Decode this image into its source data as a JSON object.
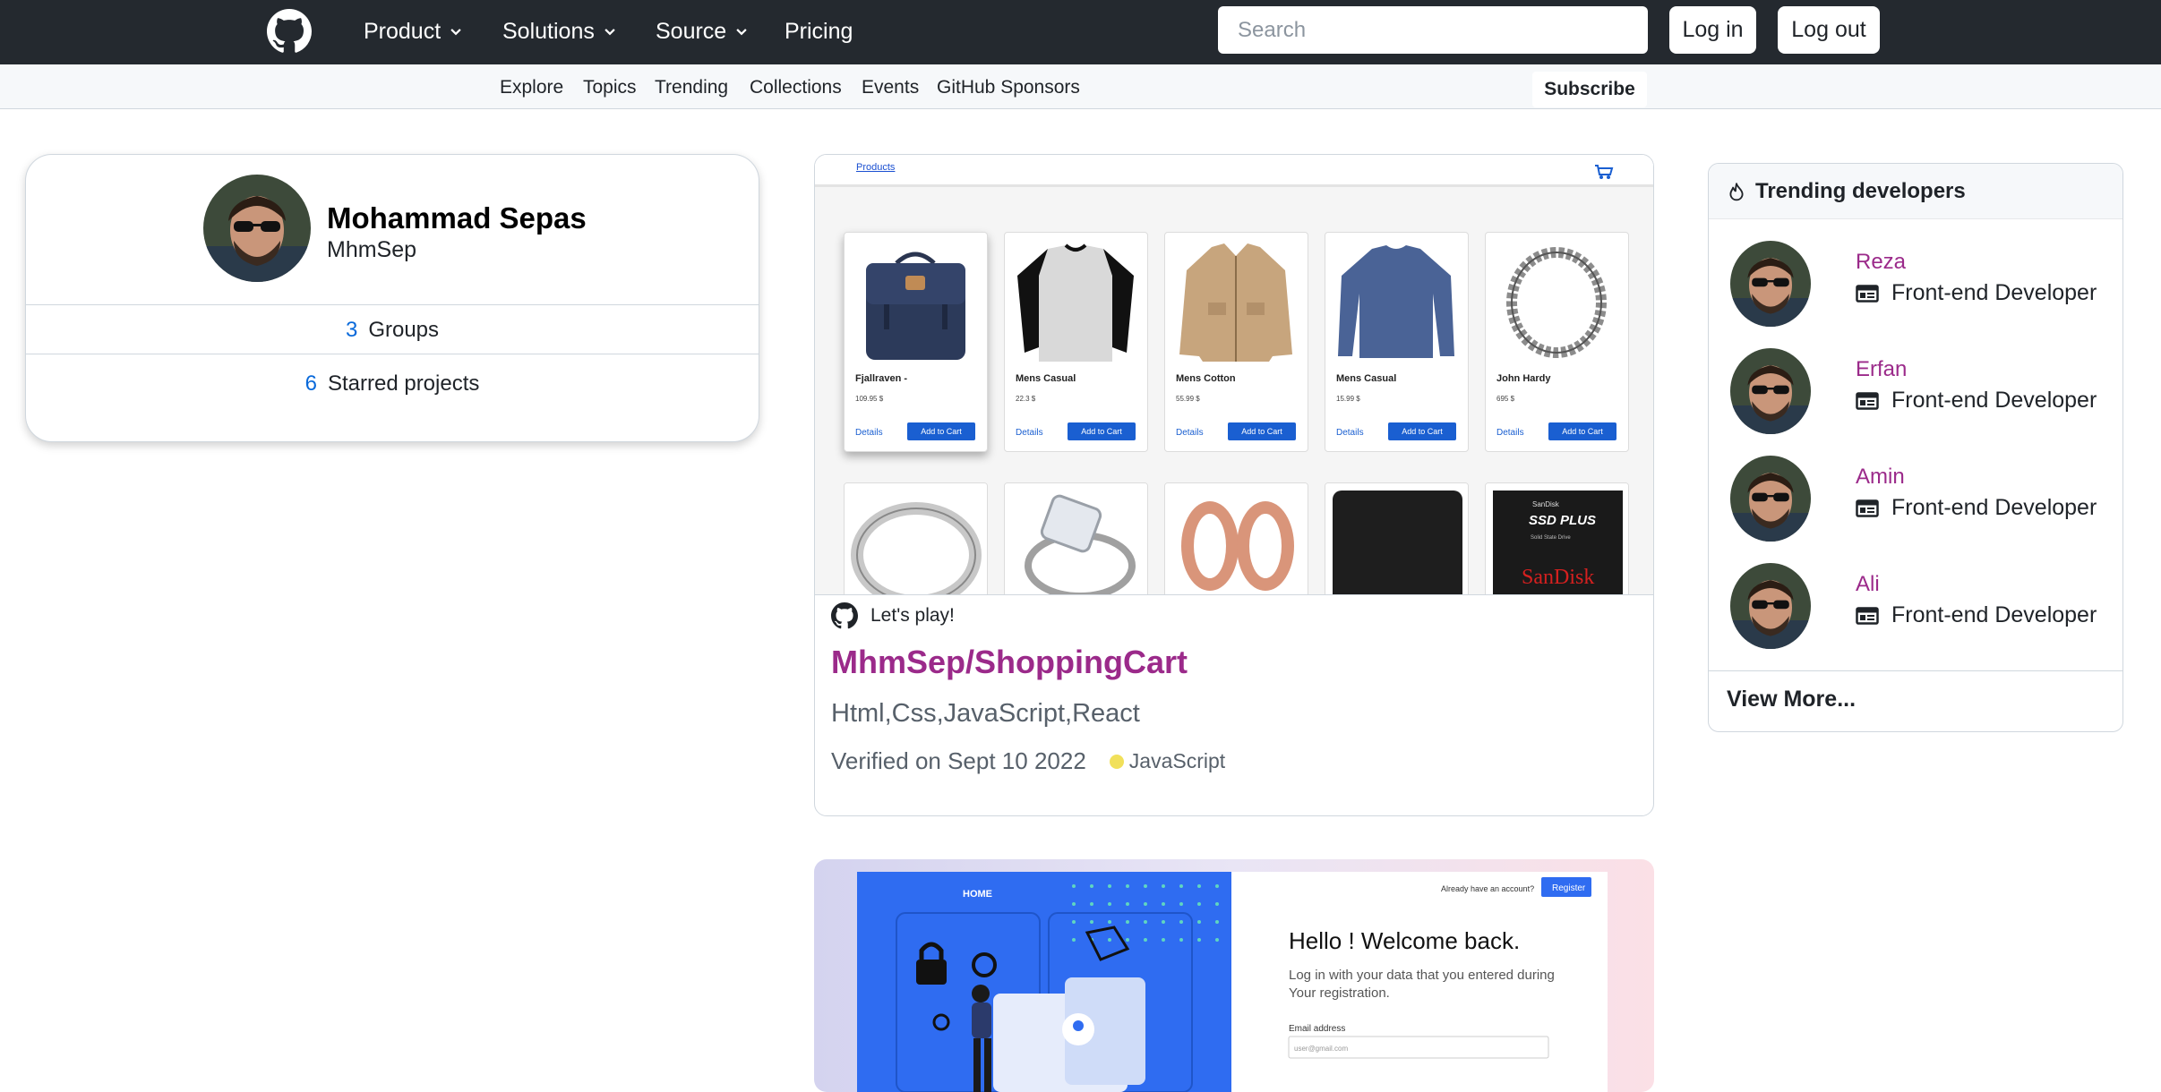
{
  "nav": {
    "items": [
      {
        "label": "Product"
      },
      {
        "label": "Solutions"
      },
      {
        "label": "Source"
      },
      {
        "label": "Pricing"
      }
    ],
    "search_placeholder": "Search",
    "login_label": "Log in",
    "logout_label": "Log out"
  },
  "subnav": {
    "items": [
      {
        "label": "Explore"
      },
      {
        "label": "Topics"
      },
      {
        "label": "Trending"
      },
      {
        "label": "Collections"
      },
      {
        "label": "Events"
      },
      {
        "label": "GitHub Sponsors"
      }
    ],
    "subscribe_label": "Subscribe"
  },
  "profile": {
    "name": "Mohammad Sepas",
    "username": "MhmSep",
    "groups_count": "3",
    "groups_label": "Groups",
    "starred_count": "6",
    "starred_label": "Starred projects"
  },
  "project": {
    "screenshot": {
      "nav_link": "Products",
      "products": [
        {
          "name": "Fjallraven -",
          "price": "109.95 $",
          "details": "Details",
          "add": "Add to Cart"
        },
        {
          "name": "Mens Casual",
          "price": "22.3 $",
          "details": "Details",
          "add": "Add to Cart"
        },
        {
          "name": "Mens Cotton",
          "price": "55.99 $",
          "details": "Details",
          "add": "Add to Cart"
        },
        {
          "name": "Mens Casual",
          "price": "15.99 $",
          "details": "Details",
          "add": "Add to Cart"
        },
        {
          "name": "John Hardy",
          "price": "695 $",
          "details": "Details",
          "add": "Add to Cart"
        }
      ],
      "ssd_brand_small": "SanDisk",
      "ssd_title": "SSD PLUS",
      "ssd_sub": "Solid State Drive",
      "ssd_brand": "SanDisk"
    },
    "tagline": "Let's play!",
    "title": "MhmSep/ShoppingCart",
    "description": "Html,Css,JavaScript,React",
    "verified": "Verified on Sept 10 2022",
    "language": "JavaScript",
    "language_color": "#f1e05a"
  },
  "project2": {
    "screenshot": {
      "home_label": "HOME",
      "already_text": "Already have an account?",
      "register_label": "Register",
      "heading": "Hello ! Welcome back.",
      "subtext": "Log in with your data that you entered during Your registration.",
      "email_label": "Email address",
      "email_placeholder": "user@gmail.com"
    }
  },
  "trending": {
    "title": "Trending developers",
    "developers": [
      {
        "name": "Reza",
        "role": "Front-end Developer"
      },
      {
        "name": "Erfan",
        "role": "Front-end Developer"
      },
      {
        "name": "Amin",
        "role": "Front-end Developer"
      },
      {
        "name": "Ali",
        "role": "Front-end Developer"
      }
    ],
    "view_more": "View More..."
  },
  "colors": {
    "nav_bg": "#24292f",
    "link_purple": "#9b2a8a",
    "accent_blue": "#0969da"
  },
  "icons": [
    "github-logo-icon",
    "chevron-down-icon",
    "flame-icon",
    "id-card-icon",
    "cart-icon"
  ]
}
